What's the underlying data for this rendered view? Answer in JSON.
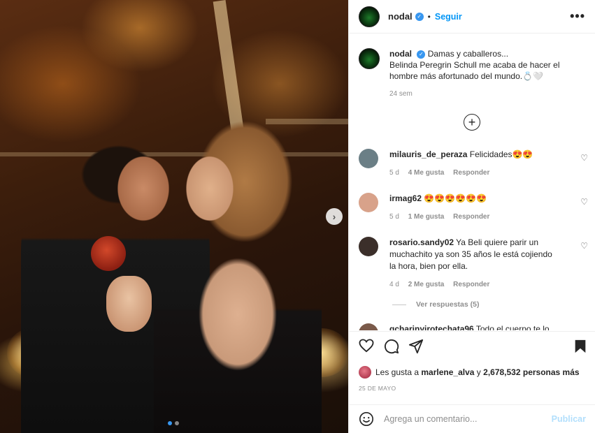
{
  "post": {
    "username": "nodal",
    "follow_label": "Seguir",
    "dot": "•",
    "more_glyph": "•••",
    "next_glyph": "›",
    "caption": {
      "username": "nodal",
      "line1": "Damas y caballeros...",
      "line2": "Belinda Peregrin Schull me acaba de hacer el hombre más afortunado del mundo.💍🤍",
      "time": "24 sem"
    },
    "load_more_glyph": "+",
    "comments": [
      {
        "username": "milauris_de_peraza",
        "text": "Felicidades😍😍",
        "time": "5 d",
        "likes": "4 Me gusta",
        "reply": "Responder",
        "avatar_color": "#6b7f86"
      },
      {
        "username": "irmag62",
        "text": "😍😍😍😍😍😍",
        "time": "5 d",
        "likes": "1 Me gusta",
        "reply": "Responder",
        "avatar_color": "#d8a28a"
      },
      {
        "username": "rosario.sandy02",
        "text": "Ya Beli quiere parir un muchachito ya son 35 años le está cojiendo la hora, bien por ella.",
        "time": "4 d",
        "likes": "2 Me gusta",
        "reply": "Responder",
        "avatar_color": "#3b2f2a"
      }
    ],
    "view_replies": "Ver respuestas (5)",
    "partial_comment": {
      "username": "gcharinyirotechata96",
      "text": "Todo el cuerpo te lo"
    },
    "likes": {
      "prefix": "Les gusta a",
      "user": "marlene_alva",
      "conj": "y",
      "count": "2,678,532 personas más"
    },
    "date": "25 DE MAYO",
    "add_comment_placeholder": "Agrega un comentario...",
    "publish_label": "Publicar"
  },
  "colors": {
    "accent": "#0095f6",
    "publish_disabled": "#b2dffc",
    "muted": "#8e8e8e",
    "text": "#262626"
  },
  "icons": [
    "verified-badge-icon",
    "more-options-icon",
    "next-arrow-icon",
    "load-more-icon",
    "heart-icon",
    "comment-icon",
    "share-icon",
    "bookmark-icon",
    "emoji-icon"
  ]
}
